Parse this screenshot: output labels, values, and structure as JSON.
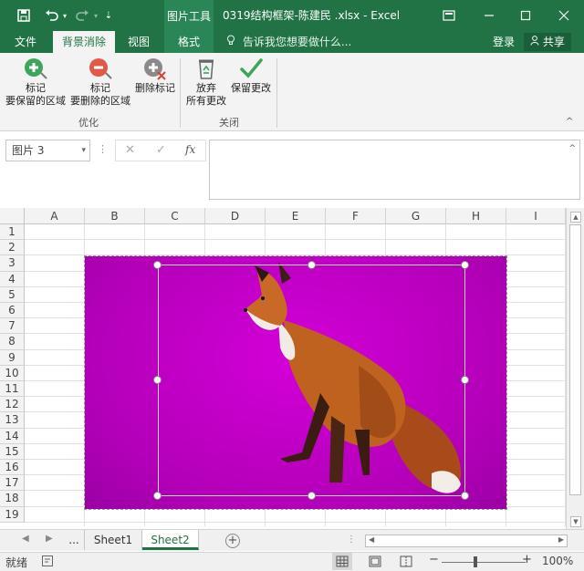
{
  "title_bar": {
    "context_tab_group": "图片工具",
    "document_title": "0319结构框架-陈建民 .xlsx - Excel",
    "ribbon_display_icon": "ribbon-display-icon",
    "window_controls": [
      "minimize-icon",
      "maximize-icon",
      "close-icon"
    ]
  },
  "tabs": {
    "items": [
      "文件",
      "背景消除",
      "视图",
      "格式"
    ],
    "active": "背景消除",
    "tell_me": "告诉我您想要做什么...",
    "login": "登录",
    "share": "共享"
  },
  "ribbon": {
    "mark_keep": {
      "line1": "标记",
      "line2": "要保留的区域"
    },
    "mark_remove": {
      "line1": "标记",
      "line2": "要删除的区域"
    },
    "delete_mark": "删除标记",
    "group_optimize": "优化",
    "discard": {
      "line1": "放弃",
      "line2": "所有更改"
    },
    "keep_changes": "保留更改",
    "group_close": "关闭"
  },
  "formula_bar": {
    "name_box": "图片 3",
    "fx": "fx",
    "value": ""
  },
  "grid": {
    "columns": [
      "A",
      "B",
      "C",
      "D",
      "E",
      "F",
      "G",
      "H",
      "I"
    ],
    "rows": [
      "1",
      "2",
      "3",
      "4",
      "5",
      "6",
      "7",
      "8",
      "9",
      "10",
      "11",
      "12",
      "13",
      "14",
      "15",
      "16",
      "17",
      "18",
      "19"
    ]
  },
  "sheets": {
    "ellipsis": "...",
    "tabs": [
      "Sheet1",
      "Sheet2"
    ],
    "active": "Sheet2",
    "add": "+"
  },
  "status": {
    "ready": "就绪",
    "zoom_minus": "−",
    "zoom_plus": "+",
    "zoom": "100%"
  },
  "colors": {
    "brand": "#217346",
    "background_removal_magenta": "#c800cc"
  }
}
